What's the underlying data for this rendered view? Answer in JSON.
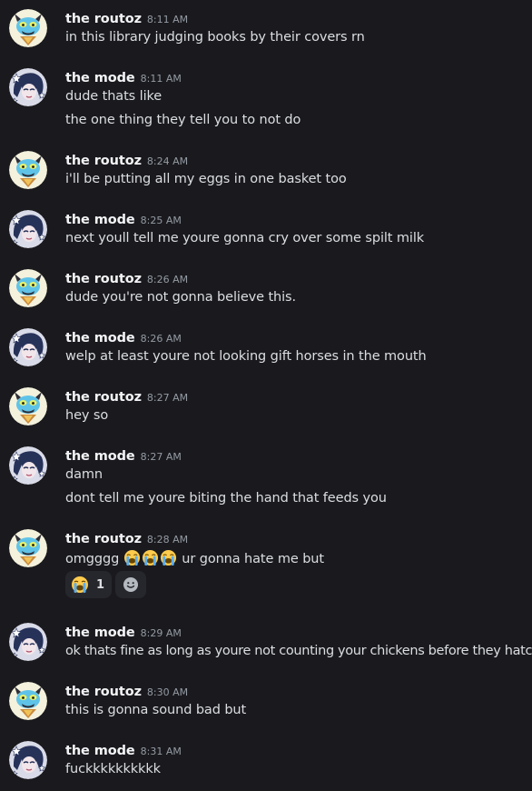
{
  "messages": [
    {
      "author": "the routoz",
      "time": "8:11 AM",
      "lines": [
        "in this library judging books by their covers rn"
      ]
    },
    {
      "author": "the mode",
      "time": "8:11 AM",
      "lines": [
        "dude thats like",
        "the one thing they tell you to not do"
      ]
    },
    {
      "author": "the routoz",
      "time": "8:24 AM",
      "lines": [
        "i'll be putting all my eggs in one basket too"
      ]
    },
    {
      "author": "the mode",
      "time": "8:25 AM",
      "lines": [
        "next youll tell me youre gonna cry over some spilt milk"
      ]
    },
    {
      "author": "the routoz",
      "time": "8:26 AM",
      "lines": [
        "dude you're not gonna believe this."
      ]
    },
    {
      "author": "the mode",
      "time": "8:26 AM",
      "lines": [
        "welp at least youre not looking gift horses in the mouth"
      ]
    },
    {
      "author": "the routoz",
      "time": "8:27 AM",
      "lines": [
        "hey so"
      ]
    },
    {
      "author": "the mode",
      "time": "8:27 AM",
      "lines": [
        "damn",
        "dont tell me youre biting the hand that feeds you"
      ]
    },
    {
      "author": "the routoz",
      "time": "8:28 AM",
      "lines": [
        "omgggg",
        "ur gonna hate me but"
      ],
      "inline_emoji": [
        "loudly-crying-face",
        "loudly-crying-face",
        "loudly-crying-face"
      ],
      "reaction": {
        "emoji": "loudly-crying-face",
        "count": "1"
      }
    },
    {
      "author": "the mode",
      "time": "8:29 AM",
      "lines": [
        "ok thats fine as long as youre not counting your chickens before they hatch"
      ]
    },
    {
      "author": "the routoz",
      "time": "8:30 AM",
      "lines": [
        "this is gonna sound bad but"
      ]
    },
    {
      "author": "the mode",
      "time": "8:31 AM",
      "lines": [
        "fuckkkkkkkkkk"
      ]
    }
  ],
  "colors": {
    "background": "#1a1a1e",
    "author": "#f2f3f5",
    "text": "#dbdee1",
    "timestamp": "#949ba4",
    "reaction_bg": "#26272d"
  }
}
